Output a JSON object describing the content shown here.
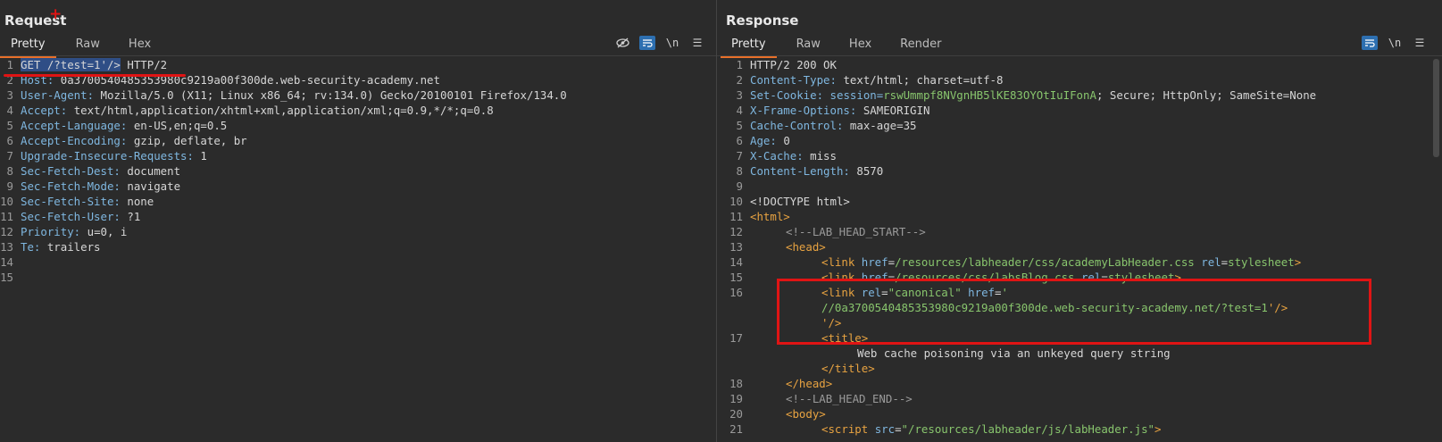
{
  "request": {
    "title": "Request",
    "tabs": [
      "Pretty",
      "Raw",
      "Hex"
    ],
    "active_tab": "Pretty",
    "toolbar_icons": [
      "eye-hidden-icon",
      "wrap-icon",
      "newline-icon",
      "menu-icon"
    ],
    "newline_label": "\\n",
    "lines": [
      {
        "n": "1",
        "sel": "GET /?test=1'/>",
        "rest": " HTTP/2"
      },
      {
        "n": "2",
        "k": "Host: ",
        "v": "0a3700540485353980c9219a00f300de.web-security-academy.net"
      },
      {
        "n": "3",
        "k": "User-Agent: ",
        "v": "Mozilla/5.0 (X11; Linux x86_64; rv:134.0) Gecko/20100101 Firefox/134.0"
      },
      {
        "n": "4",
        "k": "Accept: ",
        "v": "text/html,application/xhtml+xml,application/xml;q=0.9,*/*;q=0.8"
      },
      {
        "n": "5",
        "k": "Accept-Language: ",
        "v": "en-US,en;q=0.5"
      },
      {
        "n": "6",
        "k": "Accept-Encoding: ",
        "v": "gzip, deflate, br"
      },
      {
        "n": "7",
        "k": "Upgrade-Insecure-Requests: ",
        "v": "1"
      },
      {
        "n": "8",
        "k": "Sec-Fetch-Dest: ",
        "v": "document"
      },
      {
        "n": "9",
        "k": "Sec-Fetch-Mode: ",
        "v": "navigate"
      },
      {
        "n": "10",
        "k": "Sec-Fetch-Site: ",
        "v": "none"
      },
      {
        "n": "11",
        "k": "Sec-Fetch-User: ",
        "v": "?1"
      },
      {
        "n": "12",
        "k": "Priority: ",
        "v": "u=0, i"
      },
      {
        "n": "13",
        "k": "Te: ",
        "v": "trailers"
      },
      {
        "n": "14",
        "k": "",
        "v": ""
      },
      {
        "n": "15",
        "k": "",
        "v": ""
      }
    ]
  },
  "response": {
    "title": "Response",
    "tabs": [
      "Pretty",
      "Raw",
      "Hex",
      "Render"
    ],
    "active_tab": "Pretty",
    "toolbar_icons": [
      "wrap-icon",
      "newline-icon",
      "menu-icon"
    ],
    "newline_label": "\\n",
    "header_lines": [
      {
        "n": "1",
        "plain": "HTTP/2 200 OK"
      },
      {
        "n": "2",
        "k": "Content-Type: ",
        "v": "text/html; charset=utf-8"
      },
      {
        "n": "3",
        "k": "Set-Cookie: ",
        "cookie_name": "session=",
        "cookie_val": "rswUmmpf8NVgnHB5lKE83OYOtIuIFonA",
        "v": "; Secure; HttpOnly; SameSite=None"
      },
      {
        "n": "4",
        "k": "X-Frame-Options: ",
        "v": "SAMEORIGIN"
      },
      {
        "n": "5",
        "k": "Cache-Control: ",
        "v": "max-age=35"
      },
      {
        "n": "6",
        "k": "Age: ",
        "v": "0"
      },
      {
        "n": "7",
        "k": "X-Cache: ",
        "v": "miss"
      },
      {
        "n": "8",
        "k": "Content-Length: ",
        "v": "8570"
      },
      {
        "n": "9",
        "plain": ""
      }
    ],
    "html_lines": {
      "l10": "<!DOCTYPE html>",
      "l11": "<html>",
      "l12": "<!--LAB_HEAD_START-->",
      "l13": "<head>",
      "l14_href": "/resources/labheader/css/academyLabHeader.css",
      "l14_rel": "stylesheet",
      "l15_href": "/resources/css/labsBlog.css",
      "l15_rel": "stylesheet",
      "l16_rel": "\"canonical\"",
      "l16_href_open": "'",
      "l16_url": "//0a3700540485353980c9219a00f300de.web-security-academy.net/?test=1",
      "l16_tail": "'/>",
      "l16_cont": "'/>",
      "l17_title_text": "Web cache poisoning via an unkeyed query string",
      "l19": "<!--LAB_HEAD_END-->",
      "l20": "<body>",
      "l21_src": "\"/resources/labheader/js/labHeader.js\""
    }
  },
  "annotations": {
    "color": "#e01414"
  }
}
